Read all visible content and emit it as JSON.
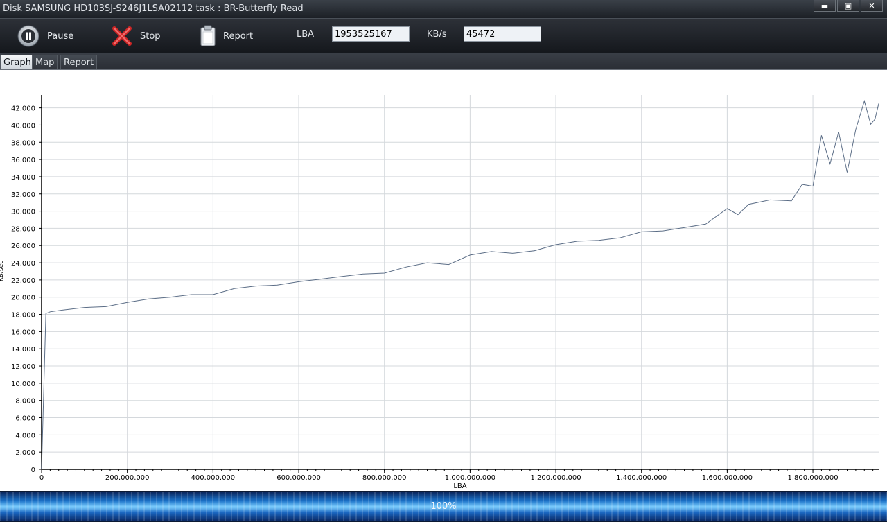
{
  "window": {
    "title": "Disk SAMSUNG HD103SJ-S246J1LSA02112   task : BR-Butterfly Read",
    "minimize_glyph": "▬",
    "restore_glyph": "▣",
    "close_glyph": "✕"
  },
  "toolbar": {
    "pause_label": "Pause",
    "stop_label": "Stop",
    "report_label": "Report",
    "lba_label": "LBA",
    "lba_value": "1953525167",
    "kbs_label": "KB/s",
    "kbs_value": "45472"
  },
  "tabs": [
    {
      "label": "Graph",
      "active": true
    },
    {
      "label": "Map",
      "active": false
    },
    {
      "label": "Report",
      "active": false
    }
  ],
  "status": {
    "progress_percent": 100,
    "progress_text": "100%"
  },
  "icons": {
    "pause": "pause-icon",
    "stop": "stop-x-icon",
    "report": "clipboard-icon"
  },
  "colors": {
    "series_line": "#5b6d86",
    "grid": "#d4d8dc",
    "axis": "#000000"
  },
  "chart_data": {
    "type": "line",
    "xlabel": "LBA",
    "ylabel": "KB/sec",
    "xlim": [
      0,
      1953525167
    ],
    "ylim": [
      0,
      43500
    ],
    "x_ticks": [
      0,
      200000000,
      400000000,
      600000000,
      800000000,
      1000000000,
      1200000000,
      1400000000,
      1600000000,
      1800000000
    ],
    "x_tick_labels": [
      "0",
      "200.000.000",
      "400.000.000",
      "600.000.000",
      "800.000.000",
      "1.000.000.000",
      "1.200.000.000",
      "1.400.000.000",
      "1.600.000.000",
      "1.800.000.000"
    ],
    "y_ticks": [
      0,
      2000,
      4000,
      6000,
      8000,
      10000,
      12000,
      14000,
      16000,
      18000,
      20000,
      22000,
      24000,
      26000,
      28000,
      30000,
      32000,
      34000,
      36000,
      38000,
      40000,
      42000
    ],
    "y_tick_labels": [
      "0",
      "2.000",
      "4.000",
      "6.000",
      "8.000",
      "10.000",
      "12.000",
      "14.000",
      "16.000",
      "18.000",
      "20.000",
      "22.000",
      "24.000",
      "26.000",
      "28.000",
      "30.000",
      "32.000",
      "34.000",
      "36.000",
      "38.000",
      "40.000",
      "42.000"
    ],
    "grid": true,
    "series": [
      {
        "x": [
          0,
          10000000,
          20000000,
          50000000,
          100000000,
          150000000,
          200000000,
          250000000,
          300000000,
          350000000,
          400000000,
          450000000,
          500000000,
          550000000,
          600000000,
          650000000,
          700000000,
          750000000,
          800000000,
          850000000,
          900000000,
          950000000,
          1000000000,
          1050000000,
          1100000000,
          1150000000,
          1200000000,
          1250000000,
          1300000000,
          1350000000,
          1400000000,
          1450000000,
          1500000000,
          1550000000,
          1600000000,
          1625000000,
          1650000000,
          1700000000,
          1750000000,
          1775000000,
          1800000000,
          1820000000,
          1840000000,
          1860000000,
          1880000000,
          1900000000,
          1920000000,
          1935000000,
          1945000000,
          1953525167
        ],
        "y": [
          0,
          18100,
          18300,
          18500,
          18800,
          18900,
          19400,
          19800,
          20000,
          20300,
          20300,
          21000,
          21300,
          21400,
          21800,
          22100,
          22400,
          22700,
          22800,
          23500,
          24000,
          23800,
          24900,
          25300,
          25100,
          25400,
          26100,
          26500,
          26600,
          26900,
          27600,
          27700,
          28100,
          28500,
          30300,
          29600,
          30800,
          31300,
          31200,
          33100,
          32900,
          38800,
          35500,
          39200,
          34500,
          39500,
          42800,
          40100,
          40700,
          42500
        ]
      }
    ]
  }
}
